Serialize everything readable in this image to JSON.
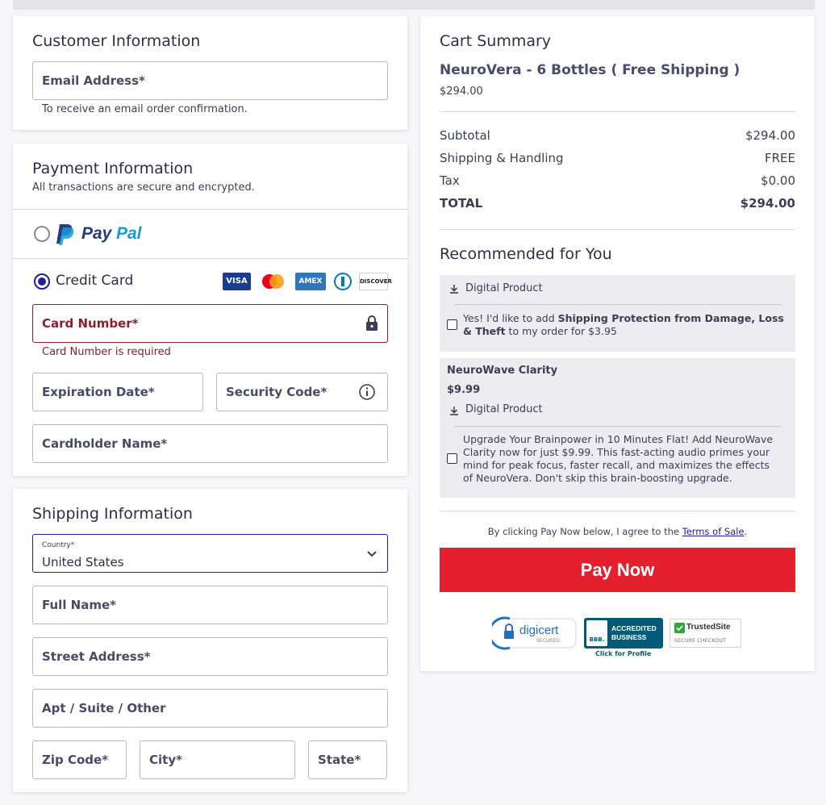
{
  "customer": {
    "title": "Customer Information",
    "email_label": "Email Address*",
    "email_help": "To receive an email order confirmation."
  },
  "payment": {
    "title": "Payment Information",
    "subtitle": "All transactions are secure and encrypted.",
    "paypal_pay": "Pay",
    "paypal_pal": "Pal",
    "credit_card_label": "Credit Card",
    "card_logos": [
      "VISA",
      "mastercard",
      "AMEX",
      "diners",
      "DISCOVER"
    ],
    "card_number_label": "Card Number*",
    "card_number_error": "Card Number is required",
    "expiration_label": "Expiration Date*",
    "security_label": "Security Code*",
    "cardholder_label": "Cardholder Name*"
  },
  "shipping": {
    "title": "Shipping Information",
    "country_label": "Country*",
    "country_value": "United States",
    "full_name_label": "Full Name*",
    "street_label": "Street Address*",
    "apt_label": "Apt / Suite / Other",
    "zip_label": "Zip Code*",
    "city_label": "City*",
    "state_label": "State*"
  },
  "cart": {
    "title": "Cart Summary",
    "product_name": "NeuroVera - 6 Bottles ( Free Shipping )",
    "product_price": "$294.00",
    "subtotal_label": "Subtotal",
    "subtotal_value": "$294.00",
    "shipping_label": "Shipping & Handling",
    "shipping_value": "FREE",
    "tax_label": "Tax",
    "tax_value": "$0.00",
    "total_label": "TOTAL",
    "total_value": "$294.00"
  },
  "recommended": {
    "title": "Recommended for You",
    "item1_type": "Digital Product",
    "item1_text_a": "Yes! I'd like to add ",
    "item1_bold": "Shipping Protection from Damage, Loss & Theft",
    "item1_text_b": " to my order for $3.95",
    "item2_name": "NeuroWave Clarity",
    "item2_price": "$9.99",
    "item2_type": "Digital Product",
    "item2_text": "Upgrade Your Brainpower in 10 Minutes Flat! Add NeuroWave Clarity now for just $9.99. This fast-acting audio primes your mind for peak focus, faster recall, and maximizes the effects of NeuroVera. Don't skip this brain-boosting upgrade."
  },
  "checkout": {
    "terms_prefix": "By clicking Pay Now below, I agree to the ",
    "terms_link": "Terms of Sale",
    "terms_suffix": ".",
    "pay_button": "Pay Now"
  },
  "badges": {
    "digicert": "digicert",
    "digicert_sub": "SECURED",
    "bbb_line1": "ACCREDITED",
    "bbb_line2": "BUSINESS",
    "bbb_mark": "BBB.",
    "bbb_click": "Click for Profile",
    "trusted": "TrustedSite",
    "trusted_sub": "SECURE CHECKOUT"
  },
  "colors": {
    "accent": "#1d1da6",
    "error": "#8b1f2a",
    "pay_button": "#e4202f",
    "paypal_dark": "#253b80",
    "paypal_light": "#179bd7"
  }
}
